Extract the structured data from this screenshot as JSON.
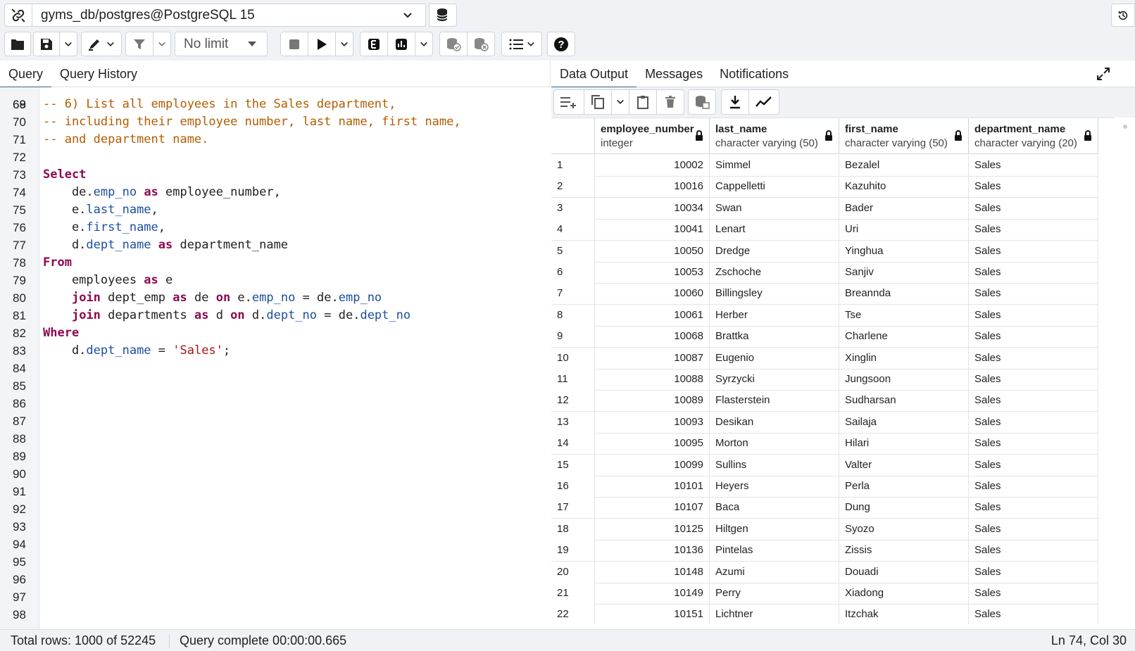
{
  "connection": {
    "label": "gyms_db/postgres@PostgreSQL 15",
    "icons": [
      "link-icon",
      "chevron-down-icon",
      "database-icon",
      "history-icon"
    ]
  },
  "toolbar": {
    "limit_label": "No limit",
    "buttons": [
      "open-file-icon",
      "save-icon",
      "edit-icon",
      "filter-icon",
      "stop-icon",
      "execute-icon",
      "explain-icon",
      "explain-analyze-icon",
      "commit-icon",
      "rollback-icon",
      "macros-icon",
      "help-icon"
    ]
  },
  "left_tabs": [
    {
      "label": "Query"
    },
    {
      "label": "Query History"
    }
  ],
  "right_tabs": [
    {
      "label": "Data Output"
    },
    {
      "label": "Messages"
    },
    {
      "label": "Notifications"
    }
  ],
  "editor": {
    "partial_top_line": "68",
    "lines": [
      {
        "n": "69",
        "tokens": [
          [
            "c-com",
            "-- 6) List all employees in the Sales department,"
          ]
        ]
      },
      {
        "n": "70",
        "tokens": [
          [
            "c-com",
            "-- including their employee number, last name, first name,"
          ]
        ]
      },
      {
        "n": "71",
        "tokens": [
          [
            "c-com",
            "-- and department name."
          ]
        ]
      },
      {
        "n": "72",
        "tokens": []
      },
      {
        "n": "73",
        "tokens": [
          [
            "c-kw",
            "Select"
          ]
        ]
      },
      {
        "n": "74",
        "tokens": [
          [
            "",
            "    de."
          ],
          [
            "c-prop",
            "emp_no"
          ],
          [
            "",
            " "
          ],
          [
            "c-as",
            "as"
          ],
          [
            "",
            " employee_number,"
          ]
        ]
      },
      {
        "n": "75",
        "tokens": [
          [
            "",
            "    e."
          ],
          [
            "c-prop",
            "last_name"
          ],
          [
            "",
            ","
          ]
        ]
      },
      {
        "n": "76",
        "tokens": [
          [
            "",
            "    e."
          ],
          [
            "c-prop",
            "first_name"
          ],
          [
            "",
            ","
          ]
        ]
      },
      {
        "n": "77",
        "tokens": [
          [
            "",
            "    d."
          ],
          [
            "c-prop",
            "dept_name"
          ],
          [
            "",
            " "
          ],
          [
            "c-as",
            "as"
          ],
          [
            "",
            " department_name"
          ]
        ]
      },
      {
        "n": "78",
        "tokens": [
          [
            "c-kw",
            "From"
          ]
        ]
      },
      {
        "n": "79",
        "tokens": [
          [
            "",
            "    employees "
          ],
          [
            "c-as",
            "as"
          ],
          [
            "",
            " e"
          ]
        ]
      },
      {
        "n": "80",
        "tokens": [
          [
            "",
            "    "
          ],
          [
            "c-kw",
            "join"
          ],
          [
            "",
            " dept_emp "
          ],
          [
            "c-as",
            "as"
          ],
          [
            "",
            " de "
          ],
          [
            "c-kw",
            "on"
          ],
          [
            "",
            " e."
          ],
          [
            "c-prop",
            "emp_no"
          ],
          [
            "",
            " = de."
          ],
          [
            "c-prop",
            "emp_no"
          ]
        ]
      },
      {
        "n": "81",
        "tokens": [
          [
            "",
            "    "
          ],
          [
            "c-kw",
            "join"
          ],
          [
            "",
            " departments "
          ],
          [
            "c-as",
            "as"
          ],
          [
            "",
            " d "
          ],
          [
            "c-kw",
            "on"
          ],
          [
            "",
            " d."
          ],
          [
            "c-prop",
            "dept_no"
          ],
          [
            "",
            " = de."
          ],
          [
            "c-prop",
            "dept_no"
          ]
        ]
      },
      {
        "n": "82",
        "tokens": [
          [
            "c-kw",
            "Where"
          ]
        ]
      },
      {
        "n": "83",
        "tokens": [
          [
            "",
            "    d."
          ],
          [
            "c-prop",
            "dept_name"
          ],
          [
            "",
            " = "
          ],
          [
            "c-str",
            "'Sales'"
          ],
          [
            "",
            ";"
          ]
        ]
      },
      {
        "n": "84",
        "tokens": []
      },
      {
        "n": "85",
        "tokens": []
      },
      {
        "n": "86",
        "tokens": []
      },
      {
        "n": "87",
        "tokens": []
      },
      {
        "n": "88",
        "tokens": []
      },
      {
        "n": "89",
        "tokens": []
      },
      {
        "n": "90",
        "tokens": []
      },
      {
        "n": "91",
        "tokens": []
      },
      {
        "n": "92",
        "tokens": []
      },
      {
        "n": "93",
        "tokens": []
      },
      {
        "n": "94",
        "tokens": []
      },
      {
        "n": "95",
        "tokens": []
      },
      {
        "n": "96",
        "tokens": []
      },
      {
        "n": "97",
        "tokens": []
      },
      {
        "n": "98",
        "tokens": []
      }
    ]
  },
  "results": {
    "columns": [
      {
        "name": "employee_number",
        "type": "integer"
      },
      {
        "name": "last_name",
        "type": "character varying (50)"
      },
      {
        "name": "first_name",
        "type": "character varying (50)"
      },
      {
        "name": "department_name",
        "type": "character varying (20)"
      }
    ],
    "rows": [
      [
        "1",
        "10002",
        "Simmel",
        "Bezalel",
        "Sales"
      ],
      [
        "2",
        "10016",
        "Cappelletti",
        "Kazuhito",
        "Sales"
      ],
      [
        "3",
        "10034",
        "Swan",
        "Bader",
        "Sales"
      ],
      [
        "4",
        "10041",
        "Lenart",
        "Uri",
        "Sales"
      ],
      [
        "5",
        "10050",
        "Dredge",
        "Yinghua",
        "Sales"
      ],
      [
        "6",
        "10053",
        "Zschoche",
        "Sanjiv",
        "Sales"
      ],
      [
        "7",
        "10060",
        "Billingsley",
        "Breannda",
        "Sales"
      ],
      [
        "8",
        "10061",
        "Herber",
        "Tse",
        "Sales"
      ],
      [
        "9",
        "10068",
        "Brattka",
        "Charlene",
        "Sales"
      ],
      [
        "10",
        "10087",
        "Eugenio",
        "Xinglin",
        "Sales"
      ],
      [
        "11",
        "10088",
        "Syrzycki",
        "Jungsoon",
        "Sales"
      ],
      [
        "12",
        "10089",
        "Flasterstein",
        "Sudharsan",
        "Sales"
      ],
      [
        "13",
        "10093",
        "Desikan",
        "Sailaja",
        "Sales"
      ],
      [
        "14",
        "10095",
        "Morton",
        "Hilari",
        "Sales"
      ],
      [
        "15",
        "10099",
        "Sullins",
        "Valter",
        "Sales"
      ],
      [
        "16",
        "10101",
        "Heyers",
        "Perla",
        "Sales"
      ],
      [
        "17",
        "10107",
        "Baca",
        "Dung",
        "Sales"
      ],
      [
        "18",
        "10125",
        "Hiltgen",
        "Syozo",
        "Sales"
      ],
      [
        "19",
        "10136",
        "Pintelas",
        "Zissis",
        "Sales"
      ],
      [
        "20",
        "10148",
        "Azumi",
        "Douadi",
        "Sales"
      ],
      [
        "21",
        "10149",
        "Perry",
        "Xiadong",
        "Sales"
      ],
      [
        "22",
        "10151",
        "Lichtner",
        "Itzchak",
        "Sales"
      ]
    ]
  },
  "status": {
    "total_rows": "Total rows: 1000 of 52245",
    "query_status": "Query complete 00:00:00.665",
    "cursor": "Ln 74, Col 30"
  }
}
